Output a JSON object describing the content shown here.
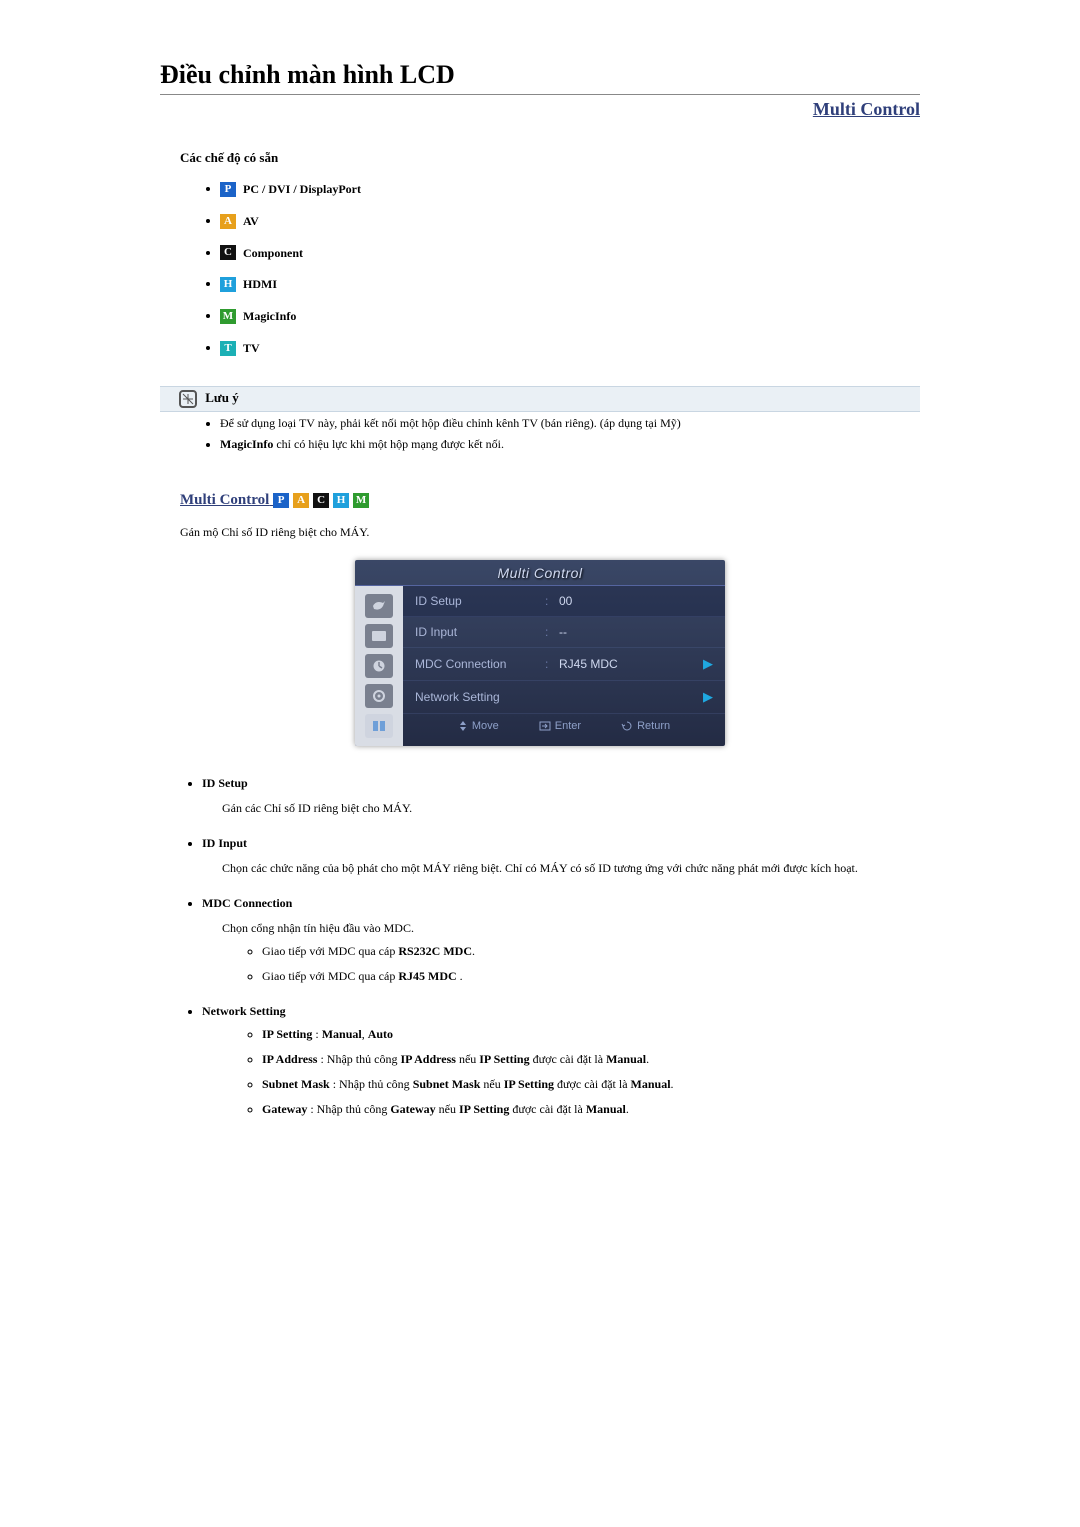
{
  "title": "Điều chỉnh màn hình LCD",
  "top_right": "Multi Control",
  "modes_label": "Các chế độ có sẵn",
  "modes": {
    "p": {
      "badge": "P",
      "label": "PC / DVI / DisplayPort"
    },
    "a": {
      "badge": "A",
      "label": "AV"
    },
    "c": {
      "badge": "C",
      "label": "Component"
    },
    "h": {
      "badge": "H",
      "label": "HDMI"
    },
    "m": {
      "badge": "M",
      "label": "MagicInfo"
    },
    "t": {
      "badge": "T",
      "label": "TV"
    }
  },
  "note": {
    "heading": "Lưu ý",
    "line1": "Để sử dụng loại TV này, phải kết nối một hộp điều chỉnh kênh TV (bán riêng). (áp dụng tại Mỹ)",
    "line2_strong": "MagicInfo",
    "line2_rest": " chỉ có hiệu lực khi một hộp mạng được kết nối."
  },
  "mc": {
    "heading": "Multi Control",
    "desc": "Gán mộ Chỉ số ID riêng biệt cho MÁY."
  },
  "osd": {
    "title": "Multi Control",
    "rows": {
      "id_setup": {
        "label": "ID Setup",
        "value": "00"
      },
      "id_input": {
        "label": "ID Input",
        "value": "--"
      },
      "mdc_conn": {
        "label": "MDC Connection",
        "value": "RJ45 MDC"
      },
      "net": {
        "label": "Network Setting",
        "value": ""
      }
    },
    "foot": {
      "move": "Move",
      "enter": "Enter",
      "return": "Return"
    }
  },
  "items": {
    "id_setup": {
      "head": "ID Setup",
      "desc": "Gán các Chỉ số ID riêng biệt cho MÁY."
    },
    "id_input": {
      "head": "ID Input",
      "desc": "Chọn các chức năng của bộ phát cho một MÁY riêng biệt. Chỉ có MÁY có số ID tương ứng với chức năng phát mới được kích hoạt."
    },
    "mdc_conn": {
      "head": "MDC Connection",
      "desc": "Chọn cổng nhận tín hiệu đầu vào MDC.",
      "sub1_pre": "Giao tiếp với MDC qua cáp ",
      "sub1_b": "RS232C MDC",
      "sub2_pre": "Giao tiếp với MDC qua cáp ",
      "sub2_b": "RJ45 MDC"
    },
    "net": {
      "head": "Network Setting",
      "ip_setting_b1": "IP Setting",
      "ip_setting_mid": " : ",
      "ip_setting_b2": "Manual",
      "ip_setting_sep": ", ",
      "ip_setting_b3": "Auto",
      "ip_addr_b1": "IP Address",
      "ip_addr_txt": " : Nhập thủ công ",
      "ip_addr_b2": "IP Address",
      "ip_addr_txt2": " nếu ",
      "ip_addr_b3": "IP Setting",
      "ip_addr_txt3": " được cài đặt là ",
      "ip_addr_b4": "Manual",
      "subnet_b1": "Subnet Mask",
      "subnet_txt": " : Nhập thủ công ",
      "subnet_b2": "Subnet Mask",
      "subnet_txt2": " nếu ",
      "subnet_b3": "IP Setting",
      "subnet_txt3": " được cài đặt là ",
      "subnet_b4": "Manual",
      "gw_b1": "Gateway",
      "gw_txt": " : Nhập thủ công ",
      "gw_b2": "Gateway",
      "gw_txt2": " nếu ",
      "gw_b3": "IP Setting",
      "gw_txt3": " được cài đặt là ",
      "gw_b4": "Manual"
    }
  }
}
